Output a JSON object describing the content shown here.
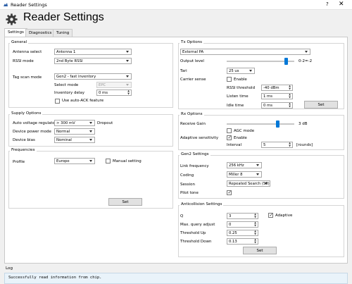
{
  "window": {
    "title": "Reader Settings",
    "help_glyph": "?",
    "close_glyph": "✕"
  },
  "header": {
    "title": "Reader Settings"
  },
  "tabs": [
    {
      "label": "Settings"
    },
    {
      "label": "Diagnostics"
    },
    {
      "label": "Tuning"
    }
  ],
  "general": {
    "title": "General",
    "antenna_select_label": "Antenna select",
    "antenna_select_value": "Antenna 1",
    "rssi_mode_label": "RSSI mode",
    "rssi_mode_value": "2nd Byte RSSI",
    "tag_scan_mode_label": "Tag scan mode",
    "tag_scan_mode_value": "Gen2 - fast inventory",
    "select_mode_label": "Select mode",
    "select_mode_value": "EPC",
    "inventory_delay_label": "Inventory delay",
    "inventory_delay_value": "0 ms",
    "auto_ack_label": "Use auto-ACK feature"
  },
  "supply": {
    "title": "Supply Options",
    "avr_label": "Auto voltage regulator",
    "avr_value": "> 300 mV",
    "dropout_label": "Dropout",
    "power_mode_label": "Device power mode",
    "power_mode_value": "Normal",
    "bias_label": "Device bias",
    "bias_value": "Nominal"
  },
  "frequencies": {
    "title": "Frequencies",
    "profile_label": "Profile",
    "profile_value": "Europe",
    "manual_label": "Manual setting",
    "set_label": "Set"
  },
  "tx": {
    "title": "Tx Options",
    "source_value": "External PA",
    "output_level_label": "Output level",
    "output_level_value": "0-2=-2",
    "output_level_fraction": 0.88,
    "tari_label": "Tari",
    "tari_value": "25 us",
    "carrier_sense_label": "Carrier sense",
    "enable_label": "Enable",
    "rssi_threshold_label": "RSSI threshold",
    "rssi_threshold_value": "-40 dBm",
    "listen_time_label": "Listen time",
    "listen_time_value": "1 ms",
    "idle_time_label": "Idle time",
    "idle_time_value": "0 ms",
    "set_label": "Set"
  },
  "rx": {
    "title": "Rx Options",
    "receive_gain_label": "Receive Gain",
    "receive_gain_value": "3 dB",
    "receive_gain_fraction": 0.75,
    "agc_label": "AGC mode",
    "adaptive_label": "Adaptive sensitivity",
    "enable_label": "Enable",
    "interval_label": "Interval",
    "interval_value": "5",
    "rounds_label": "[rounds]"
  },
  "gen2": {
    "title": "Gen2 Settings",
    "link_frequency_label": "Link frequency",
    "link_frequency_value": "256 kHz",
    "coding_label": "Coding",
    "coding_value": "Miller 8",
    "session_label": "Session",
    "session_value": "Repeated Search (S0)",
    "pilot_tone_label": "Pilot tone"
  },
  "anticollision": {
    "title": "Anticollision Settings",
    "q_label": "Q",
    "q_value": "3",
    "adaptive_label": "Adaptive",
    "max_query_label": "Max. query adjust",
    "max_query_value": "0",
    "threshold_up_label": "Threshold Up",
    "threshold_up_value": "0.25",
    "threshold_down_label": "Threshold Down",
    "threshold_down_value": "0.13",
    "set_label": "Set"
  },
  "log": {
    "label": "Log",
    "message": "Successfully read information from chip."
  },
  "colors": {
    "accent": "#0078d7",
    "log_bg": "#e9f3fa"
  }
}
